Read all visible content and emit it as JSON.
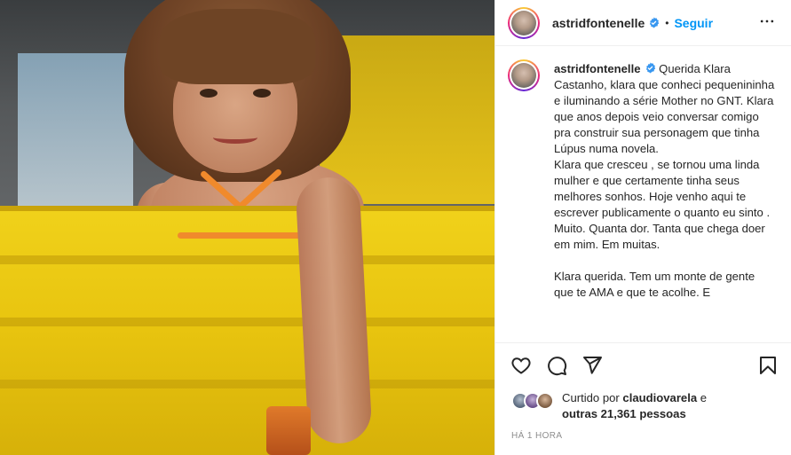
{
  "post": {
    "username": "astridfontenelle",
    "follow_label": "Seguir",
    "separator": "•",
    "caption_text": "Querida Klara Castanho, klara que conheci pequenininha e iluminando a série Mother no GNT. Klara que anos depois veio conversar comigo pra construir sua personagem que tinha Lúpus numa novela.\nKlara que cresceu , se tornou uma linda mulher e que certamente tinha seus melhores sonhos. Hoje venho aqui te escrever publicamente o quanto eu sinto . Muito. Quanta dor. Tanta que chega doer em mim. Em muitas.\n\nKlara querida. Tem um monte de gente que te AMA e que te acolhe. E",
    "likes_prefix": "Curtido por",
    "likes_user": "claudiovarela",
    "likes_and": "e",
    "likes_others": "outras 21,361 pessoas",
    "time_label": "HÁ 1 HORA"
  },
  "icons": {
    "verified": "verified-badge-icon",
    "more": "more-options-icon",
    "like": "heart-icon",
    "comment": "comment-icon",
    "share": "share-icon",
    "save": "bookmark-icon"
  },
  "colors": {
    "link_blue": "#0095f6",
    "text": "#262626",
    "muted": "#8e8e8e",
    "verified": "#3897f0"
  }
}
